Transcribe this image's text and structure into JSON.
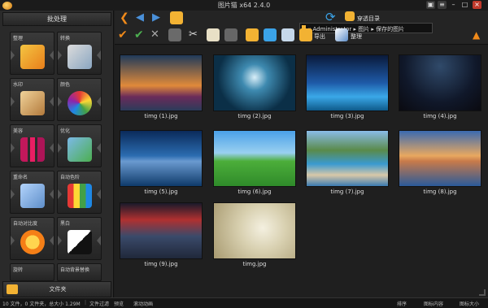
{
  "window": {
    "title": "图片猫 x64 2.4.0"
  },
  "sidebar": {
    "header": "批处理",
    "tiles": [
      {
        "label": "整理",
        "icon": "photo-stack-icon"
      },
      {
        "label": "转换",
        "icon": "convert-icon"
      },
      {
        "label": "水印",
        "icon": "watermark-icon"
      },
      {
        "label": "颜色",
        "icon": "color-palette-icon"
      },
      {
        "label": "美容",
        "icon": "cosmetics-icon"
      },
      {
        "label": "优化",
        "icon": "optimize-icon"
      },
      {
        "label": "重命名",
        "icon": "rename-icon"
      },
      {
        "label": "自动色阶",
        "icon": "auto-levels-icon"
      },
      {
        "label": "自动对比度",
        "icon": "auto-contrast-icon"
      },
      {
        "label": "黑白",
        "icon": "black-white-icon"
      },
      {
        "label": "旋转",
        "icon": "rotate-icon"
      },
      {
        "label": "自动背景替换",
        "icon": "background-replace-icon"
      }
    ],
    "folder_label": "文件夹"
  },
  "toolbar": {
    "address_prefix": "« Administrator ▸ 图片 ▸ 保存的图片",
    "passthrough_label": "穿透目录",
    "export_label": "导出",
    "organize_label": "整理"
  },
  "gallery": {
    "items": [
      {
        "name": "timg (1).jpg"
      },
      {
        "name": "timg (2).jpg"
      },
      {
        "name": "timg (3).jpg"
      },
      {
        "name": "timg (4).jpg"
      },
      {
        "name": "timg (5).jpg"
      },
      {
        "name": "timg (6).jpg"
      },
      {
        "name": "timg (7).jpg"
      },
      {
        "name": "timg (8).jpg"
      },
      {
        "name": "timg (9).jpg"
      },
      {
        "name": "timg.jpg"
      }
    ]
  },
  "status": {
    "summary": "10 文件，0 文件夹，总大小 1.29M",
    "filter_label": "文件过滤",
    "preview_label": "预览",
    "smooth_scroll_label": "滚动动画",
    "sort_label": "排序",
    "view_content_label": "图标内容",
    "icon_size_label": "图标大小"
  },
  "colors": {
    "accent": "#f08a1a",
    "panel": "#2a2a2a",
    "background": "#1f1f1f"
  }
}
